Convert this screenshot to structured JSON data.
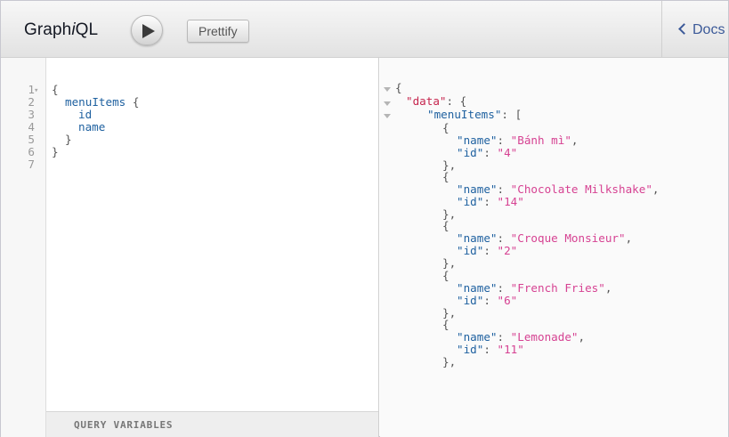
{
  "toolbar": {
    "title_prefix": "Graph",
    "title_italic": "i",
    "title_suffix": "QL",
    "prettify_label": "Prettify",
    "docs_label": "Docs"
  },
  "query_editor": {
    "line_numbers": [
      "1",
      "2",
      "3",
      "4",
      "5",
      "6",
      "7"
    ],
    "open_brace": "{",
    "field_menu": "menuItems",
    "field_id": "id",
    "field_name": "name",
    "close_brace": "}",
    "query_variables_label": "QUERY VARIABLES"
  },
  "result": {
    "data_key": "\"data\"",
    "menu_key": "\"menuItems\"",
    "name_key": "\"name\"",
    "id_key": "\"id\"",
    "items": [
      {
        "name": "\"Bánh mì\"",
        "id": "\"4\""
      },
      {
        "name": "\"Chocolate Milkshake\"",
        "id": "\"14\""
      },
      {
        "name": "\"Croque Monsieur\"",
        "id": "\"2\""
      },
      {
        "name": "\"French Fries\"",
        "id": "\"6\""
      },
      {
        "name": "\"Lemonade\"",
        "id": "\"11\""
      }
    ]
  }
}
